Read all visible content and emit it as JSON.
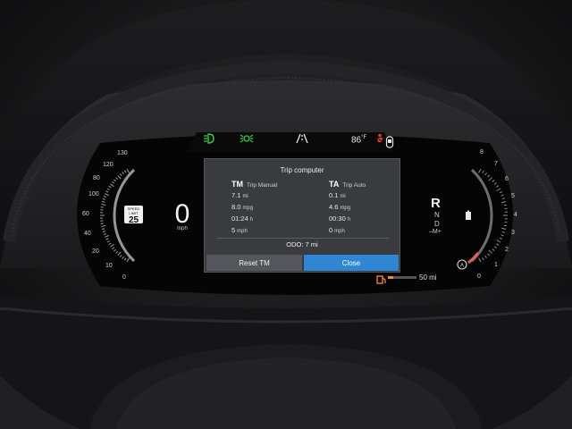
{
  "cluster": {
    "temperature": "86",
    "temperature_unit": "°F",
    "speed": "0",
    "speed_unit": "mph",
    "speed_limit_top": "SPEED LIMIT",
    "speed_limit_value": "25",
    "speedometer_labels": [
      "130",
      "120",
      "110",
      "100",
      "80",
      "60",
      "40",
      "20",
      "10",
      "0"
    ],
    "tachometer_labels": [
      "8",
      "7",
      "6",
      "5",
      "4",
      "3",
      "2",
      "1",
      "0"
    ],
    "gear": {
      "current": "R",
      "next": "N",
      "drive": "D",
      "manual": "–M+"
    },
    "range": "50 mi",
    "accent_color": "#ff8a1a"
  },
  "trip_popup": {
    "title": "Trip computer",
    "manual": {
      "abbr": "TM",
      "label": "Trip Manual",
      "distance": "7.1",
      "distance_unit": "mi",
      "economy": "8.0",
      "economy_unit": "mpg",
      "time": "01:24",
      "time_unit": "h",
      "avg_speed": "5",
      "avg_speed_unit": "mph"
    },
    "auto": {
      "abbr": "TA",
      "label": "Trip Auto",
      "distance": "0.1",
      "distance_unit": "mi",
      "economy": "4.6",
      "economy_unit": "mpg",
      "time": "00:30",
      "time_unit": "h",
      "avg_speed": "0",
      "avg_speed_unit": "mph"
    },
    "odo_label": "ODO:",
    "odo_value": "7 mi",
    "reset_label": "Reset TM",
    "close_label": "Close",
    "close_color": "#2f86d4"
  },
  "icons": [
    "headlight-icon",
    "parking-light-icon",
    "lane-assist-icon",
    "seatbelt-warning-icon",
    "door-open-icon",
    "fuel-pump-icon",
    "auto-hold-icon",
    "battery-icon"
  ]
}
